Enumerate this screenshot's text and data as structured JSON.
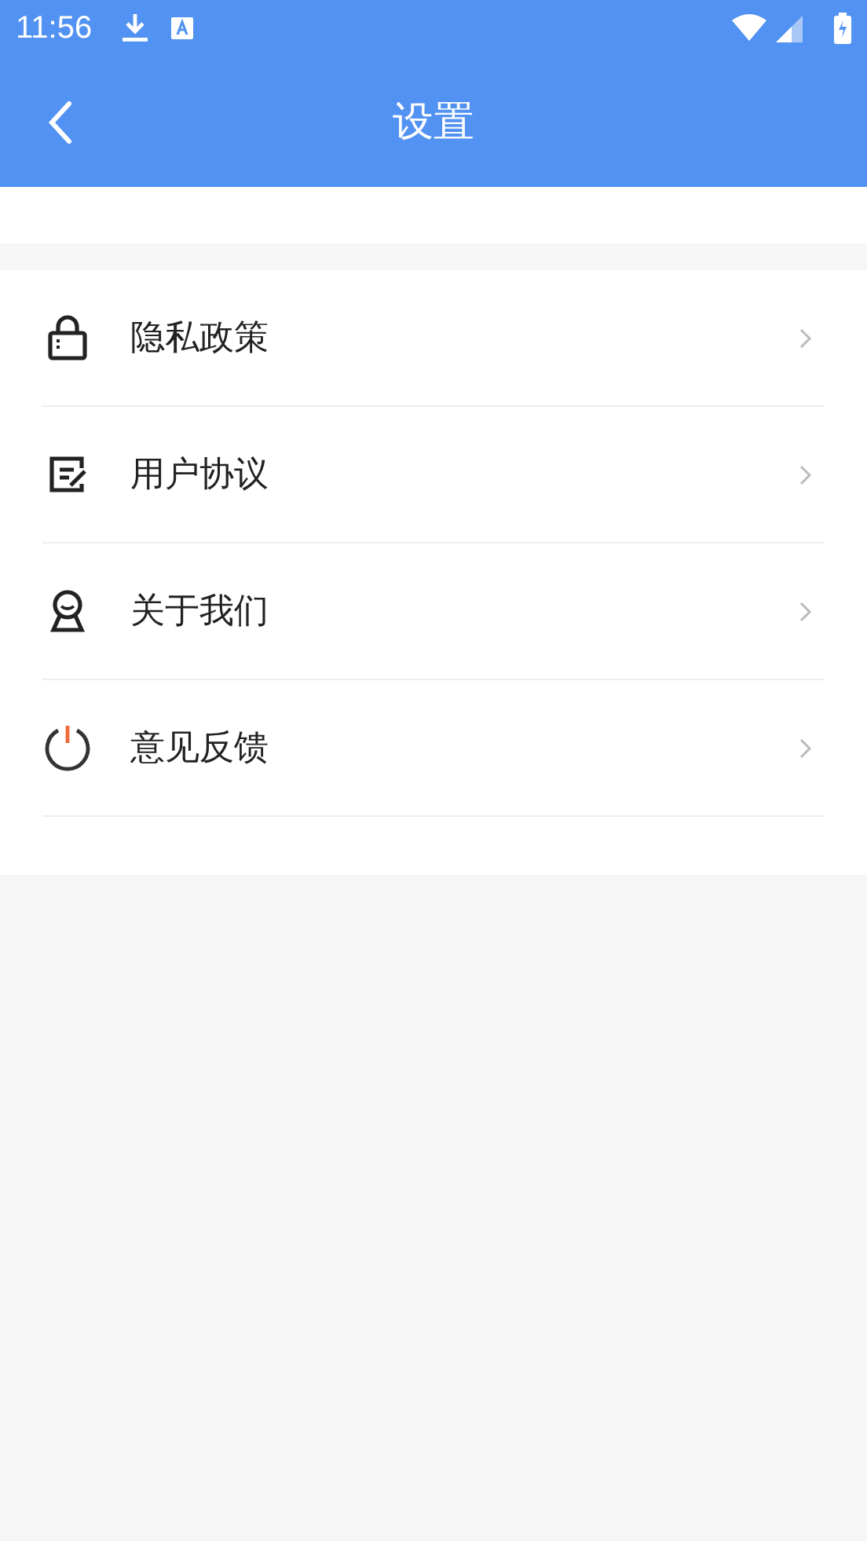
{
  "status_bar": {
    "time": "11:56"
  },
  "header": {
    "title": "设置"
  },
  "items": [
    {
      "label": "隐私政策",
      "kind": "lock"
    },
    {
      "label": "用户协议",
      "kind": "edit"
    },
    {
      "label": "关于我们",
      "kind": "person"
    },
    {
      "label": "意见反馈",
      "kind": "power"
    }
  ]
}
